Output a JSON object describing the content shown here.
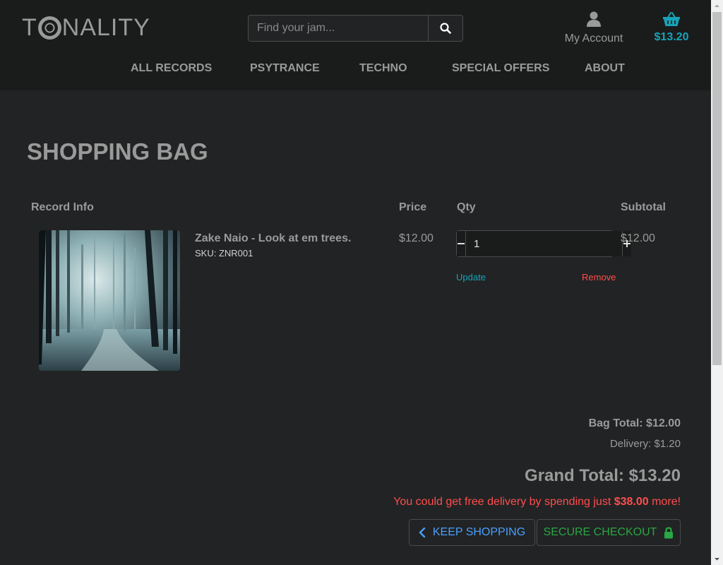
{
  "brand": {
    "name_prefix": "T",
    "name_suffix": "NALITY"
  },
  "search": {
    "placeholder": "Find your jam..."
  },
  "account": {
    "label": "My Account"
  },
  "basket": {
    "total": "$13.20"
  },
  "nav": {
    "items": [
      "ALL RECORDS",
      "PSYTRANCE",
      "TECHNO",
      "SPECIAL OFFERS",
      "ABOUT"
    ]
  },
  "page": {
    "title": "SHOPPING BAG"
  },
  "table": {
    "headers": [
      "Record Info",
      "Price",
      "Qty",
      "Subtotal"
    ]
  },
  "item": {
    "name": "Zake Naio - Look at em trees.",
    "sku": "SKU: ZNR001",
    "price": "$12.00",
    "qty": "1",
    "subtotal": "$12.00",
    "update_label": "Update",
    "remove_label": "Remove"
  },
  "summary": {
    "bag_total": "Bag Total: $12.00",
    "delivery": "Delivery: $1.20",
    "grand_total": "Grand Total: $13.20",
    "free_delivery_pre": "You could get free delivery by spending just ",
    "free_delivery_amount": "$38.00",
    "free_delivery_post": " more!"
  },
  "buttons": {
    "keep_shopping": "KEEP SHOPPING",
    "secure_checkout": "SECURE CHECKOUT"
  },
  "colors": {
    "accent_teal": "#17a2b8",
    "danger": "#ff4e4e",
    "success": "#28a745",
    "link_blue": "#4a9fff"
  }
}
